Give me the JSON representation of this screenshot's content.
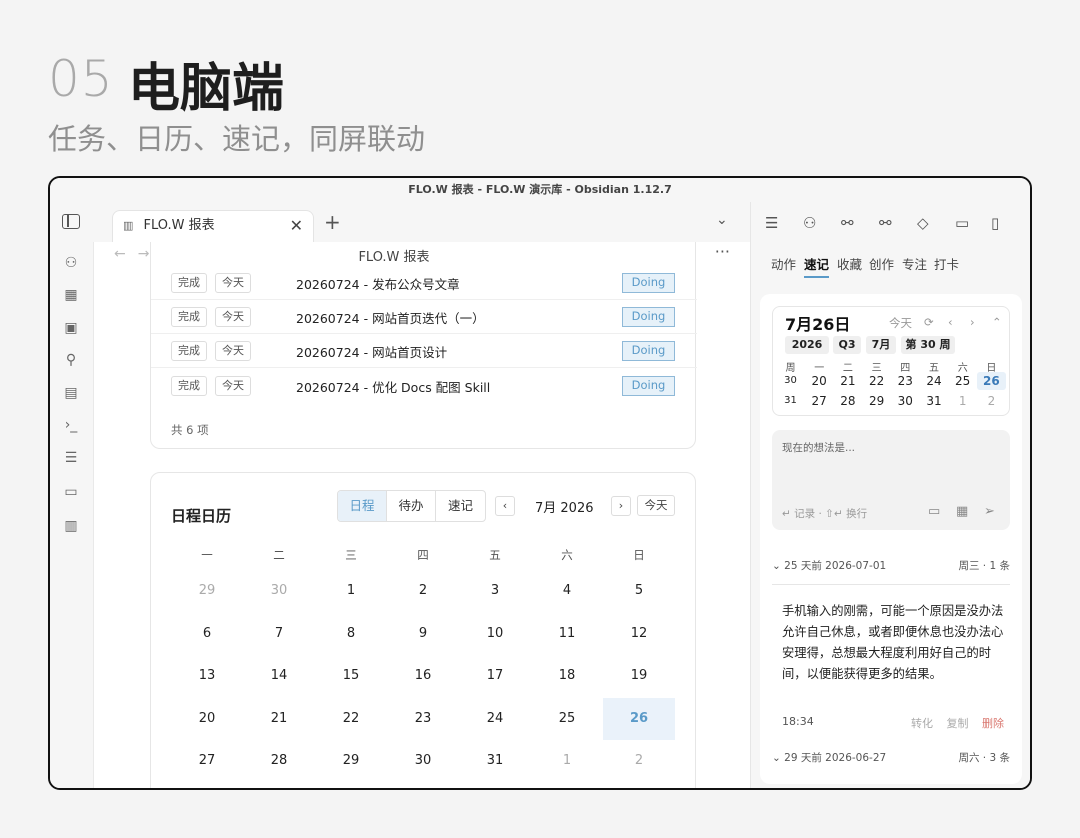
{
  "hero": {
    "number": "05",
    "title": "电脑端",
    "subtitle": "任务、日历、速记，同屏联动"
  },
  "window": {
    "title": "FLO.W 报表 - FLO.W 演示库 - Obsidian 1.12.7"
  },
  "tab": {
    "label": "FLO.W 报表",
    "close": "✕",
    "new": "+"
  },
  "doc": {
    "title": "FLO.W 报表"
  },
  "tasks": {
    "rows": [
      {
        "done": "完成",
        "today": "今天",
        "text": "20260724 - 发布公众号文章",
        "status": "Doing"
      },
      {
        "done": "完成",
        "today": "今天",
        "text": "20260724 - 网站首页迭代（一）",
        "status": "Doing"
      },
      {
        "done": "完成",
        "today": "今天",
        "text": "20260724 - 网站首页设计",
        "status": "Doing"
      },
      {
        "done": "完成",
        "today": "今天",
        "text": "20260724 - 优化 Docs 配图 Skill",
        "status": "Doing"
      }
    ],
    "total": "共 6 项"
  },
  "calendar": {
    "title": "日程日历",
    "segments": [
      "日程",
      "待办",
      "速记"
    ],
    "prev": "‹",
    "next": "›",
    "month": "7月 2026",
    "today_btn": "今天",
    "weekdays": [
      "一",
      "二",
      "三",
      "四",
      "五",
      "六",
      "日"
    ],
    "weeks": [
      [
        "29",
        "30",
        "1",
        "2",
        "3",
        "4",
        "5"
      ],
      [
        "6",
        "7",
        "8",
        "9",
        "10",
        "11",
        "12"
      ],
      [
        "13",
        "14",
        "15",
        "16",
        "17",
        "18",
        "19"
      ],
      [
        "20",
        "21",
        "22",
        "23",
        "24",
        "25",
        "26"
      ],
      [
        "27",
        "28",
        "29",
        "30",
        "31",
        "1",
        "2"
      ]
    ]
  },
  "right": {
    "tabs": [
      "动作",
      "速记",
      "收藏",
      "创作",
      "专注",
      "打卡"
    ],
    "mini": {
      "date": "7月26日",
      "today": "今天",
      "refresh": "⟳",
      "prev": "‹",
      "next": "›",
      "up": "⌃",
      "chips": [
        "2026",
        "Q3",
        "7月",
        "第 30 周"
      ],
      "weekdays": [
        "周",
        "一",
        "二",
        "三",
        "四",
        "五",
        "六",
        "日"
      ],
      "rows": [
        [
          "30",
          "20",
          "21",
          "22",
          "23",
          "24",
          "25",
          "26"
        ],
        [
          "31",
          "27",
          "28",
          "29",
          "30",
          "31",
          "1",
          "2"
        ]
      ]
    },
    "note": {
      "placeholder": "现在的想法是...",
      "hint": "↵ 记录 · ⇧↵ 换行"
    },
    "groups": [
      {
        "left": "⌄ 25 天前 2026-07-01",
        "right": "周三 · 1 条"
      },
      {
        "left": "⌄ 29 天前 2026-06-27",
        "right": "周六 · 3 条"
      }
    ],
    "entry": {
      "text": "手机输入的刚需，可能一个原因是没办法允许自己休息，或者即便休息也没办法心安理得，总想最大程度利用好自己的时间，以便能获得更多的结果。",
      "time": "18:34",
      "convert": "转化",
      "copy": "复制",
      "delete": "删除"
    }
  }
}
